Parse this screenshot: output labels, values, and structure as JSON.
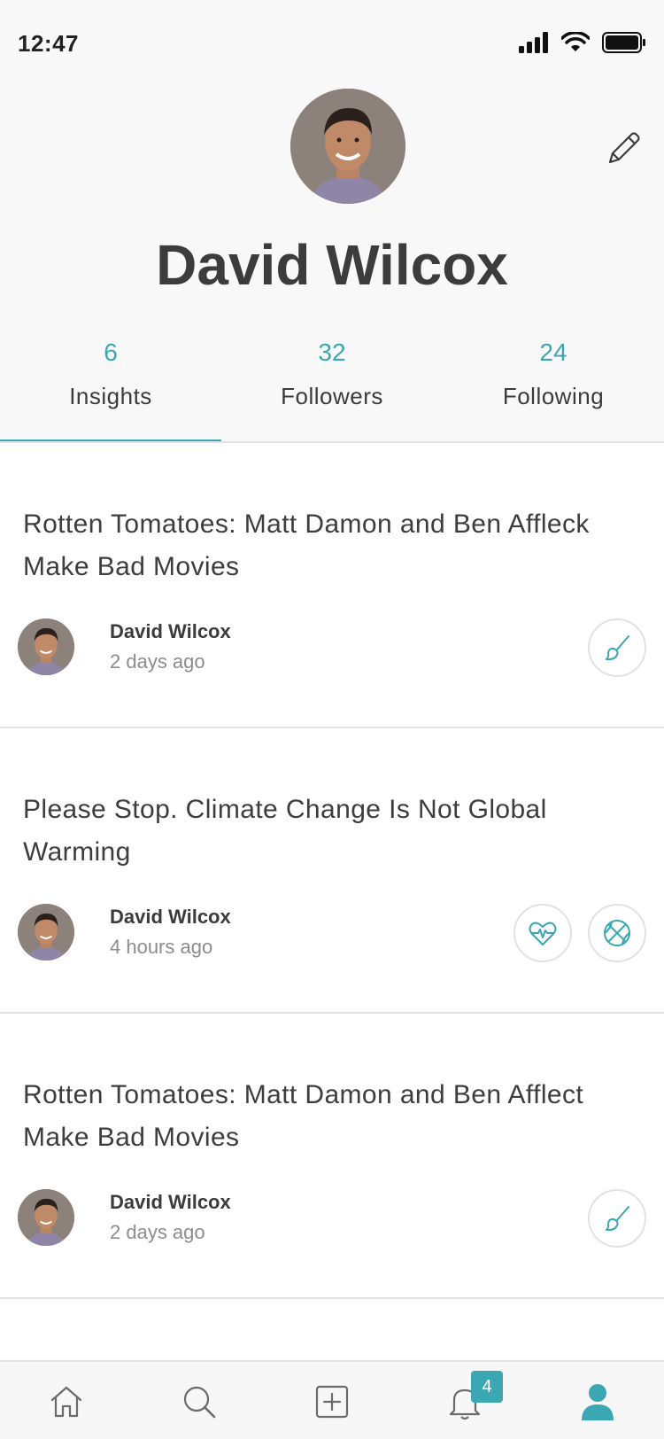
{
  "status_bar": {
    "time": "12:47"
  },
  "profile": {
    "name": "David Wilcox"
  },
  "tabs": [
    {
      "count": "6",
      "label": "Insights",
      "active": true
    },
    {
      "count": "32",
      "label": "Followers",
      "active": false
    },
    {
      "count": "24",
      "label": "Following",
      "active": false
    }
  ],
  "feed": [
    {
      "title": "Rotten Tomatoes: Matt Damon and Ben Affleck Make Bad Movies",
      "author": "David Wilcox",
      "time": "2 days ago",
      "tags": [
        "paintbrush-icon"
      ]
    },
    {
      "title": "Please Stop. Climate Change Is Not Global Warming",
      "author": "David Wilcox",
      "time": "4 hours ago",
      "tags": [
        "heartbeat-icon",
        "basketball-icon"
      ]
    },
    {
      "title": "Rotten Tomatoes: Matt Damon and Ben Afflect Make Bad Movies",
      "author": "David Wilcox",
      "time": "2 days ago",
      "tags": [
        "paintbrush-icon"
      ]
    }
  ],
  "bottom_nav": {
    "items": [
      "home-icon",
      "search-icon",
      "add-icon",
      "bell-icon",
      "profile-icon"
    ],
    "notification_count": "4",
    "active": "profile-icon"
  },
  "colors": {
    "accent": "#3aa7b2",
    "text": "#3c3c3c",
    "muted": "#8c8c8c"
  }
}
